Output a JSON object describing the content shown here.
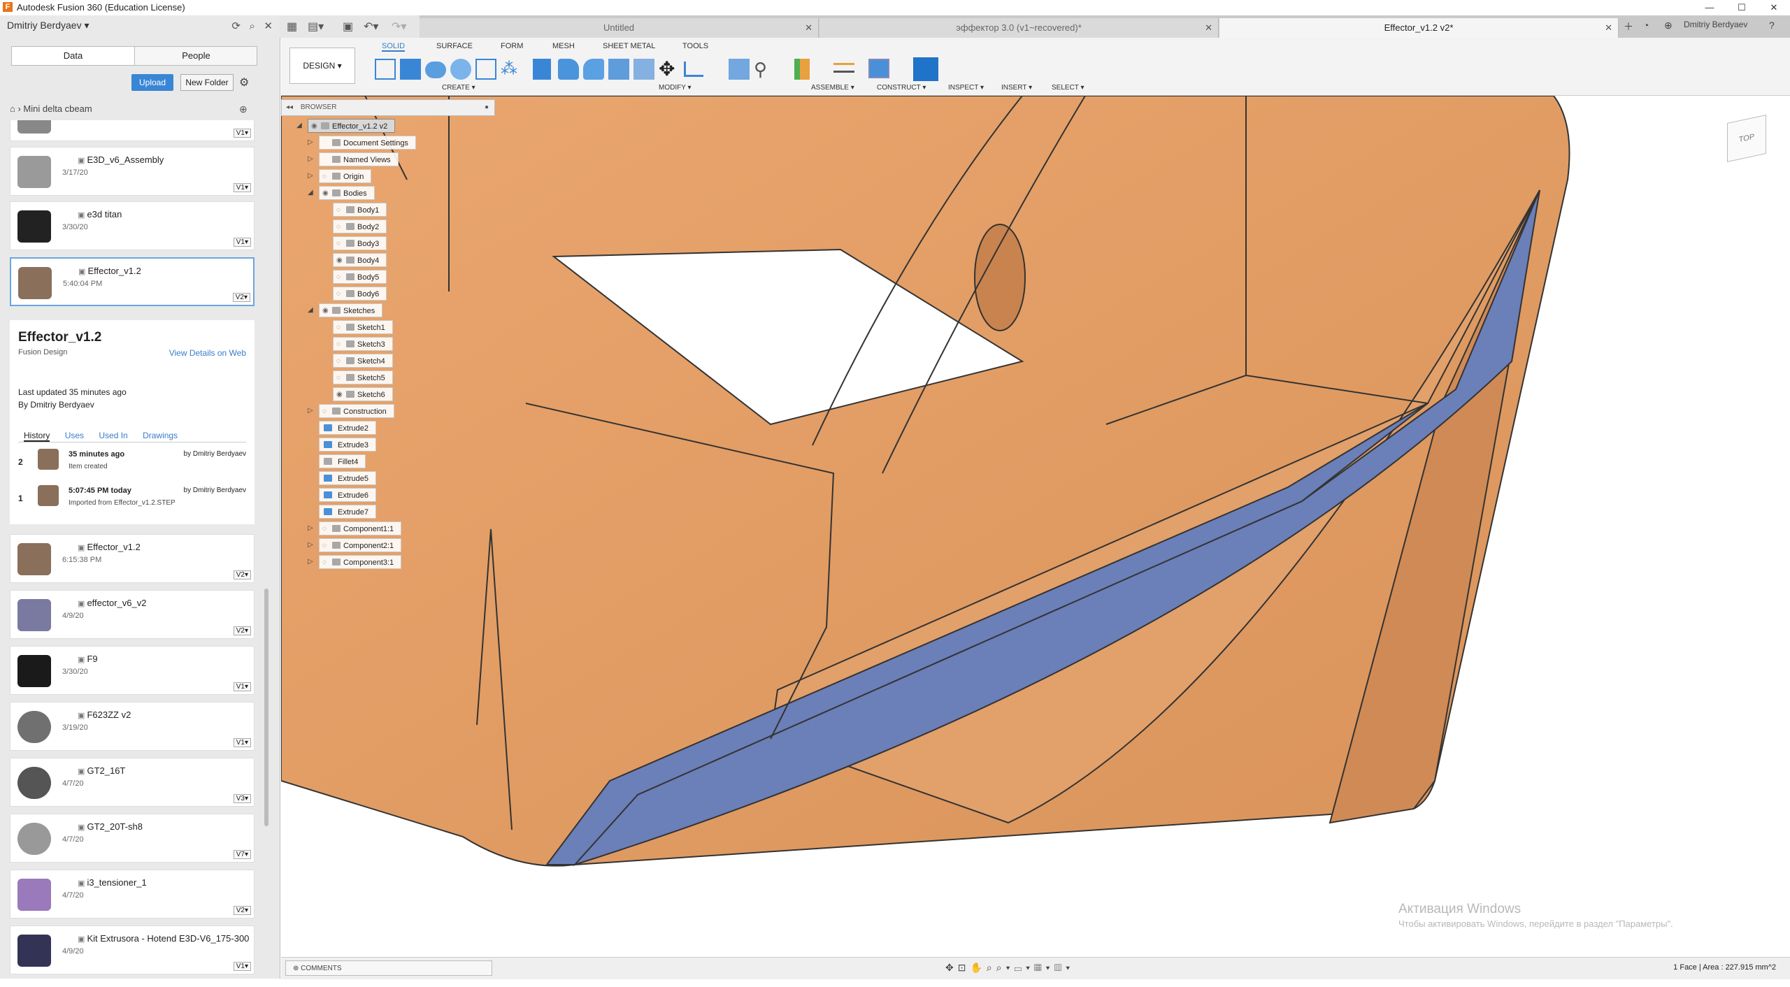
{
  "title": "Autodesk Fusion 360 (Education License)",
  "tabs": [
    {
      "label": "Untitled",
      "active": false
    },
    {
      "label": "эффектор 3.0 (v1~recovered)*",
      "active": false
    },
    {
      "label": "Effector_v1.2 v2*",
      "active": true
    }
  ],
  "account_user": "Dmitriy Berdyaev",
  "panel": {
    "user": "Dmitriy Berdyaev",
    "seg_data": "Data",
    "seg_people": "People",
    "upload": "Upload",
    "new_folder": "New Folder",
    "breadcrumb": "Mini delta cbeam",
    "items": [
      {
        "name": "",
        "date": "",
        "ver": "V1▾"
      },
      {
        "name": "E3D_v6_Assembly",
        "date": "3/17/20",
        "ver": "V1▾"
      },
      {
        "name": "e3d titan",
        "date": "3/30/20",
        "ver": "V1▾"
      },
      {
        "name": "Effector_v1.2",
        "date": "5:40:04 PM",
        "ver": "V2▾"
      },
      {
        "name": "Effector_v1.2",
        "date": "6:15:38 PM",
        "ver": "V2▾"
      },
      {
        "name": "effector_v6_v2",
        "date": "4/9/20",
        "ver": "V2▾"
      },
      {
        "name": "F9",
        "date": "3/30/20",
        "ver": "V1▾"
      },
      {
        "name": "F623ZZ v2",
        "date": "3/19/20",
        "ver": "V1▾"
      },
      {
        "name": "GT2_16T",
        "date": "4/7/20",
        "ver": "V3▾"
      },
      {
        "name": "GT2_20T-sh8",
        "date": "4/7/20",
        "ver": "V7▾"
      },
      {
        "name": "i3_tensioner_1",
        "date": "4/7/20",
        "ver": "V2▾"
      },
      {
        "name": "Kit Extrusora - Hotend E3D-V6_175-300",
        "date": "4/9/20",
        "ver": "V1▾"
      }
    ],
    "detail": {
      "title": "Effector_v1.2",
      "kind": "Fusion Design",
      "view_web": "View Details on Web",
      "last_updated": "Last updated 35 minutes ago",
      "by": "By Dmitriy Berdyaev",
      "tabs": [
        "History",
        "Uses",
        "Used In",
        "Drawings"
      ],
      "history": [
        {
          "n": "2",
          "when": "35 minutes ago",
          "who": "by Dmitriy Berdyaev",
          "desc": "Item created"
        },
        {
          "n": "1",
          "when": "5:07:45 PM today",
          "who": "by Dmitriy Berdyaev",
          "desc": "Imported from Effector_v1.2.STEP"
        }
      ]
    }
  },
  "toolbar": {
    "workspace": "DESIGN ▾",
    "tabs": [
      "SOLID",
      "SURFACE",
      "FORM",
      "MESH",
      "SHEET METAL",
      "TOOLS"
    ],
    "groups": [
      "CREATE ▾",
      "MODIFY ▾",
      "ASSEMBLE ▾",
      "CONSTRUCT ▾",
      "INSPECT ▾",
      "INSERT ▾",
      "SELECT ▾"
    ]
  },
  "browser": {
    "header": "BROWSER",
    "nodes": [
      "Effector_v1.2 v2",
      "Document Settings",
      "Named Views",
      "Origin",
      "Bodies",
      "Body1",
      "Body2",
      "Body3",
      "Body4",
      "Body5",
      "Body6",
      "Sketches",
      "Sketch1",
      "Sketch3",
      "Sketch4",
      "Sketch5",
      "Sketch6",
      "Construction",
      "Extrude2",
      "Extrude3",
      "Fillet4",
      "Extrude5",
      "Extrude6",
      "Extrude7",
      "Component1:1",
      "Component2:1",
      "Component3:1"
    ]
  },
  "viewcube": "TOP",
  "comments": "COMMENTS",
  "status": "1 Face | Area : 227.915 mm^2",
  "activation": {
    "line1": "Активация Windows",
    "line2": "Чтобы активировать Windows, перейдите в раздел \"Параметры\"."
  },
  "colors": {
    "model": "#E9A66E",
    "selected_face": "#6B7FB8",
    "accent": "#3A86D6"
  }
}
